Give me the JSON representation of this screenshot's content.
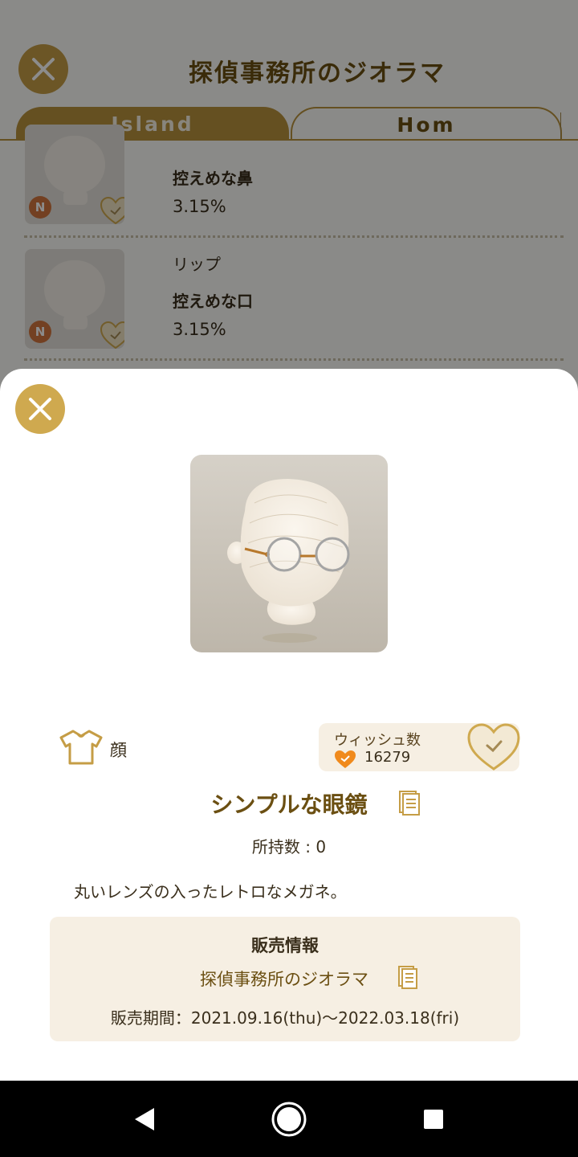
{
  "background": {
    "title": "探偵事務所のジオラマ",
    "tabs": [
      {
        "label": "Island"
      },
      {
        "label": "Hom"
      }
    ],
    "list_items": [
      {
        "category": "",
        "name": "控えめな鼻",
        "rate": "3.15%",
        "badge": "N"
      },
      {
        "category": "リップ",
        "name": "控えめな口",
        "rate": "3.15%",
        "badge": "N"
      }
    ]
  },
  "sheet": {
    "category": "顔",
    "wish": {
      "label": "ウィッシュ数",
      "count": "16279"
    },
    "item_title": "シンプルな眼鏡",
    "owned": "所持数 : 0",
    "description": "丸いレンズの入ったレトロなメガネ。",
    "sale": {
      "title": "販売情報",
      "shop": "探偵事務所のジオラマ",
      "period": "販売期間：2021.09.16(thu)〜2022.03.18(fri)"
    }
  },
  "colors": {
    "gold": "#cfa94f",
    "dark_gold": "#6b4f12",
    "badge_orange": "#d2763e",
    "wish_heart": "#f08a1c",
    "info_bg": "#f6efe3"
  },
  "icons": [
    "close-icon",
    "shirt-icon",
    "heart-icon",
    "check-icon",
    "copy-icon",
    "back-icon",
    "home-icon",
    "recents-icon"
  ]
}
